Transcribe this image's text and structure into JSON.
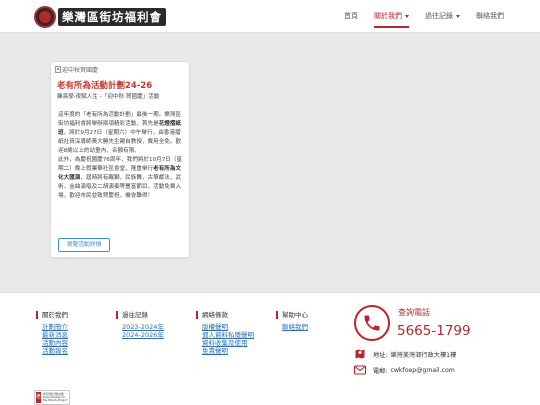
{
  "header": {
    "logo_text": "樂灣區街坊福利會",
    "nav": [
      {
        "label": "首頁",
        "active": false,
        "dropdown": false
      },
      {
        "label": "關於我們",
        "active": true,
        "dropdown": true
      },
      {
        "label": "過往記錄",
        "active": false,
        "dropdown": true
      },
      {
        "label": "聯絡我們",
        "active": false,
        "dropdown": false
      }
    ]
  },
  "card": {
    "image_alt": "迎中秋賀國慶",
    "title": "老有所為活動計劃24-26",
    "subtitle": "離喪學·夜賦人生 -「迎中秋·賀國慶」活動",
    "body_html": "這年度的「老有所為活動計劃」最後一期。樂灣區街坊福利會將舉辦兩項精彩活動，首先是<b>花燈摺紙班</b>，將於9月27日（星期六）中午舉行，由香港摺紙社資深導師黃大勝先生親自教授，費用全免。歡迎8歲以上的幼童內、名額有限。<br>此外，為慶祝國慶76周年，我們將於10月7日（星期二）晚上假業華社區會堂，隆重舉行<b>老有所為文化大匯演</b>，屆時將有醒獅，民族舞，古箏獻法，武術，金曲演唱及二胡演奏等豐富節目，活動免費入場，歡迎市民並致賀慶祝，機會難得！",
    "button": "瀏覽活動詳情"
  },
  "footer": {
    "columns": [
      {
        "heading": "關於我們",
        "links": [
          "計劃簡介",
          "最新消息",
          "活動內容",
          "活動報名"
        ]
      },
      {
        "heading": "過往記錄",
        "links": [
          "2023-2024年",
          "2024-2026年"
        ]
      },
      {
        "heading": "網絡條款",
        "links": [
          "版權聲明",
          "個人資料私隱聲明",
          "資料收集及使用",
          "免責聲明"
        ]
      },
      {
        "heading": "幫助中心",
        "links": [
          "聯絡我們"
        ]
      }
    ],
    "contact": {
      "phone_label": "查詢電話",
      "phone_number": "5665-1799",
      "address_label": "地址:",
      "address": "樂灣美灣邨行政大樓1樓",
      "email_label": "電郵:",
      "email": "cwkfoep@gmail.com"
    },
    "sponsor": {
      "line1": "老有所為活動計劃",
      "line2": "Opportunities for the Elderly Project"
    }
  },
  "colors": {
    "brand_red": "#b8262d",
    "link_blue": "#2e6fb6",
    "button_blue": "#3b8fd6"
  }
}
